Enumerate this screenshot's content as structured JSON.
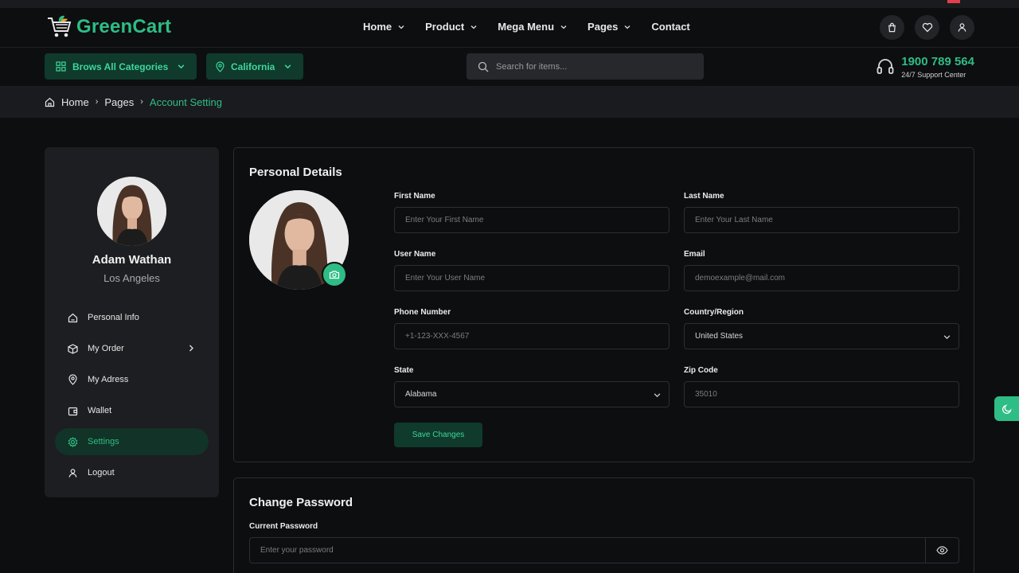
{
  "brand": {
    "name": "GreenCart",
    "color": "#2ebd85"
  },
  "nav": [
    {
      "label": "Home",
      "has_dropdown": true
    },
    {
      "label": "Product",
      "has_dropdown": true
    },
    {
      "label": "Mega Menu",
      "has_dropdown": true
    },
    {
      "label": "Pages",
      "has_dropdown": true
    },
    {
      "label": "Contact",
      "has_dropdown": false
    }
  ],
  "header_icons": [
    "shopping-bag-icon",
    "heart-icon",
    "user-icon"
  ],
  "subbar": {
    "categories_label": "Brows All Categories",
    "location_label": "California",
    "search_placeholder": "Search for items...",
    "support_phone": "1900 789 564",
    "support_label": "24/7 Support Center"
  },
  "breadcrumb": [
    "Home",
    "Pages",
    "Account Setting"
  ],
  "profile": {
    "name": "Adam Wathan",
    "location": "Los Angeles"
  },
  "sidebar_menu": [
    {
      "label": "Personal Info",
      "icon": "home-icon",
      "active": false
    },
    {
      "label": "My Order",
      "icon": "box-icon",
      "active": false,
      "has_arrow": true
    },
    {
      "label": "My Adress",
      "icon": "map-pin-icon",
      "active": false
    },
    {
      "label": "Wallet",
      "icon": "wallet-icon",
      "active": false
    },
    {
      "label": "Settings",
      "icon": "settings-icon",
      "active": true
    },
    {
      "label": "Logout",
      "icon": "user-icon",
      "active": false
    }
  ],
  "personal_details": {
    "title": "Personal Details",
    "fields": {
      "first_name": {
        "label": "First Name",
        "placeholder": "Enter Your First Name"
      },
      "last_name": {
        "label": "Last Name",
        "placeholder": "Enter Your Last Name"
      },
      "user_name": {
        "label": "User Name",
        "placeholder": "Enter Your User Name"
      },
      "email": {
        "label": "Email",
        "placeholder": "demoexample@mail.com"
      },
      "phone": {
        "label": "Phone Number",
        "placeholder": "+1-123-XXX-4567"
      },
      "country": {
        "label": "Country/Region",
        "value": "United States"
      },
      "state": {
        "label": "State",
        "value": "Alabama"
      },
      "zip": {
        "label": "Zip Code",
        "placeholder": "35010"
      }
    },
    "save_label": "Save Changes"
  },
  "change_password": {
    "title": "Change Password",
    "current_label": "Current Password",
    "current_placeholder": "Enter your password"
  }
}
